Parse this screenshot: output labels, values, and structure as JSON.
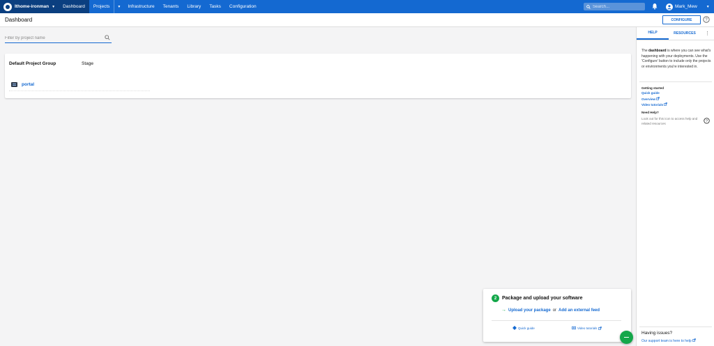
{
  "topbar": {
    "space_name": "Ithome-ironman",
    "nav": [
      "Dashboard",
      "Projects",
      "Infrastructure",
      "Tenants",
      "Library",
      "Tasks",
      "Configuration"
    ],
    "search_placeholder": "Search...",
    "user_name": "Mark_Mew"
  },
  "header": {
    "title": "Dashboard",
    "configure_label": "CONFIGURE"
  },
  "filter": {
    "placeholder": "Filter by project name"
  },
  "dashboard": {
    "group_name": "Default Project Group",
    "stage_label": "Stage",
    "projects": [
      {
        "name": "portal"
      }
    ]
  },
  "help_panel": {
    "tabs": [
      "HELP",
      "RESOURCES"
    ],
    "intro_pre": "The ",
    "intro_bold": "dashboard",
    "intro_post": " is where you can see what's happening with your deployments. Use the 'Configure' button to include only the projects or environments you're interested in.",
    "getting_started": "Getting started",
    "links": [
      "Quick guide",
      "Overview",
      "Video tutorials"
    ],
    "need_help_title": "Need Help?",
    "need_help_text": "Look out for this icon to access help and related resources",
    "issues_title": "Having issues?",
    "issues_link": "Our support team is here to help"
  },
  "onboarding": {
    "step": "2",
    "title": "Package and upload your software",
    "upload_link": "Upload your package",
    "or_text": "or",
    "feed_link": "Add an external feed",
    "quick_guide": "Quick guide",
    "video_tutorials": "Video tutorials"
  },
  "colors": {
    "accent": "#1469d1",
    "nav_dark": "#0b3f80",
    "success": "#14a74a"
  }
}
